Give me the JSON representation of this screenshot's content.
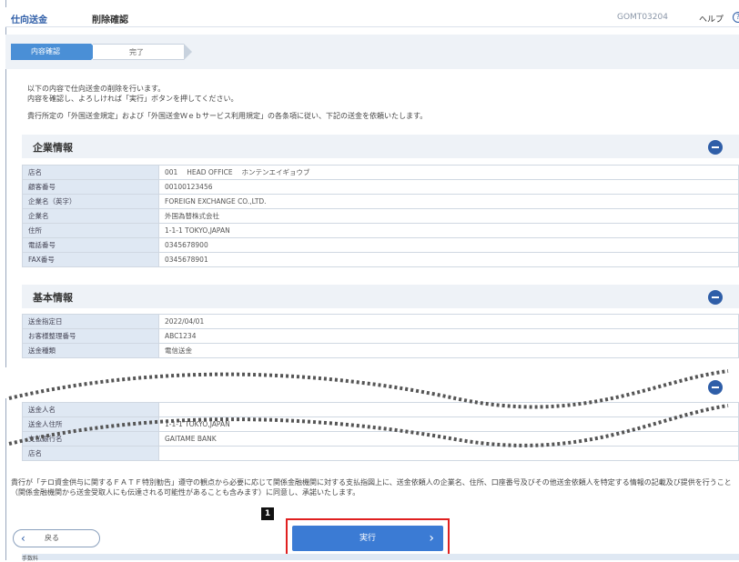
{
  "header": {
    "section": "仕向送金",
    "title": "削除確認",
    "screen_code": "GOMT03204",
    "help_label": "ヘルプ",
    "help_icon": "?"
  },
  "steps": [
    {
      "label": "内容確認"
    },
    {
      "label": "完了"
    }
  ],
  "intro": {
    "line1": "以下の内容で仕向送金の削除を行います。",
    "line2": "内容を確認し、よろしければ「実行」ボタンを押してください。",
    "notice": "貴行所定の「外国送金規定」および「外国送金Ｗｅｂサービス利用規定」の各条項に従い、下記の送金を依頼いたします。"
  },
  "company": {
    "title": "企業情報",
    "rows": [
      {
        "k": "店名",
        "v": "001　 HEAD OFFICE　 ホンテンエイギョウブ"
      },
      {
        "k": "顧客番号",
        "v": "00100123456"
      },
      {
        "k": "企業名（英字）",
        "v": "FOREIGN EXCHANGE CO.,LTD."
      },
      {
        "k": "企業名",
        "v": "外国為替株式会社"
      },
      {
        "k": "住所",
        "v": "1-1-1 TOKYO,JAPAN"
      },
      {
        "k": "電話番号",
        "v": "0345678900"
      },
      {
        "k": "FAX番号",
        "v": "0345678901"
      }
    ]
  },
  "basic": {
    "title": "基本情報",
    "rows": [
      {
        "k": "送金指定日",
        "v": "2022/04/01"
      },
      {
        "k": "お客様整理番号",
        "v": "ABC1234"
      },
      {
        "k": "送金種類",
        "v": "電信送金"
      }
    ]
  },
  "lower_rows": [
    {
      "k": "送金人名",
      "v": ""
    },
    {
      "k": "送金人住所",
      "v": "1-1-1 TOKYO,JAPAN"
    },
    {
      "k": "支払銀行名",
      "v": "GAITAME BANK"
    },
    {
      "k": "店名",
      "v": ""
    }
  ],
  "footer": {
    "consent": "貴行が「テロ資金供与に関するＦＡＴＦ特別勧告」遵守の観点から必要に応じて関係金融機関に対する支払指図上に、送金依頼人の企業名、住所、口座番号及びその他送金依頼人を特定する情報の記載及び提供を行うこと（関係金融機関から送金受取人にも伝達される可能性があることも含みます）に同意し、承諾いたします。",
    "back_label": "戻る",
    "execute_label": "実行",
    "badge": "1",
    "bottom_label": "手数料"
  },
  "colors": {
    "accent": "#3b7bd4",
    "highlight": "#e02020"
  }
}
